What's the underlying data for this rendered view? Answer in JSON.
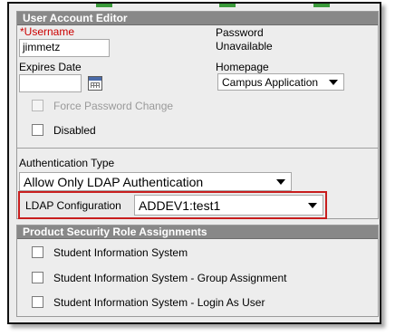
{
  "user_account_editor": {
    "title": "User Account Editor",
    "username_required_marker": "*",
    "username_label": "Username",
    "username_value": "jimmetz",
    "password_label": "Password",
    "password_status": "Unavailable",
    "expires_date_label": "Expires Date",
    "expires_date_value": "",
    "calendar_icon": "calendar-icon",
    "homepage_label": "Homepage",
    "homepage_value": "Campus Application",
    "force_password_change_label": "Force Password Change",
    "force_password_change_checked": false,
    "force_password_change_enabled": false,
    "disabled_label": "Disabled",
    "disabled_checked": false,
    "authentication_type_label": "Authentication Type",
    "authentication_type_value": "Allow Only LDAP Authentication",
    "ldap_configuration_label": "LDAP Configuration",
    "ldap_configuration_value": "ADDEV1:test1",
    "highlight_color": "#c81e1e"
  },
  "product_security_role_assignments": {
    "title": "Product Security Role Assignments",
    "items": [
      {
        "label": "Student Information System",
        "checked": false
      },
      {
        "label": "Student Information System - Group Assignment",
        "checked": false
      },
      {
        "label": "Student Information System - Login As User",
        "checked": false
      }
    ]
  }
}
